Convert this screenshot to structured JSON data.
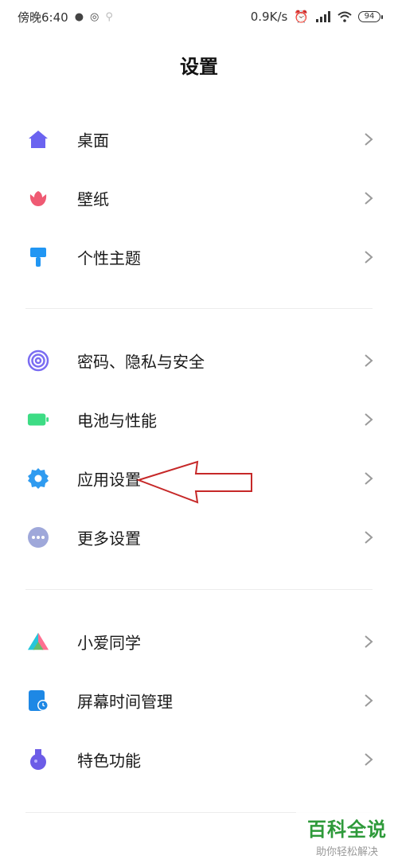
{
  "status_bar": {
    "time": "傍晚6:40",
    "speed": "0.9K/s",
    "battery": "94"
  },
  "page": {
    "title": "设置"
  },
  "sections": [
    {
      "items": [
        {
          "label": "桌面",
          "icon": "home-icon",
          "color": "#6b63f0"
        },
        {
          "label": "壁纸",
          "icon": "flower-icon",
          "color": "#ef5a73"
        },
        {
          "label": "个性主题",
          "icon": "paintbrush-icon",
          "color": "#2196f3"
        }
      ]
    },
    {
      "items": [
        {
          "label": "密码、隐私与安全",
          "icon": "fingerprint-icon",
          "color": "#7a6cf2"
        },
        {
          "label": "电池与性能",
          "icon": "battery-icon",
          "color": "#3ddc84"
        },
        {
          "label": "应用设置",
          "icon": "gear-icon",
          "color": "#2f9bf0"
        },
        {
          "label": "更多设置",
          "icon": "more-icon",
          "color": "#9fa8da"
        }
      ]
    },
    {
      "items": [
        {
          "label": "小爱同学",
          "icon": "xiaoai-icon",
          "color": "#4caf50"
        },
        {
          "label": "屏幕时间管理",
          "icon": "screen-time-icon",
          "color": "#1e88e5"
        },
        {
          "label": "特色功能",
          "icon": "flask-icon",
          "color": "#6c5ce7"
        }
      ]
    }
  ],
  "annotation_arrow": {
    "color": "#c62828",
    "points_to": "应用设置"
  },
  "watermark": {
    "title": "百科全说",
    "subtitle": "助你轻松解决"
  }
}
